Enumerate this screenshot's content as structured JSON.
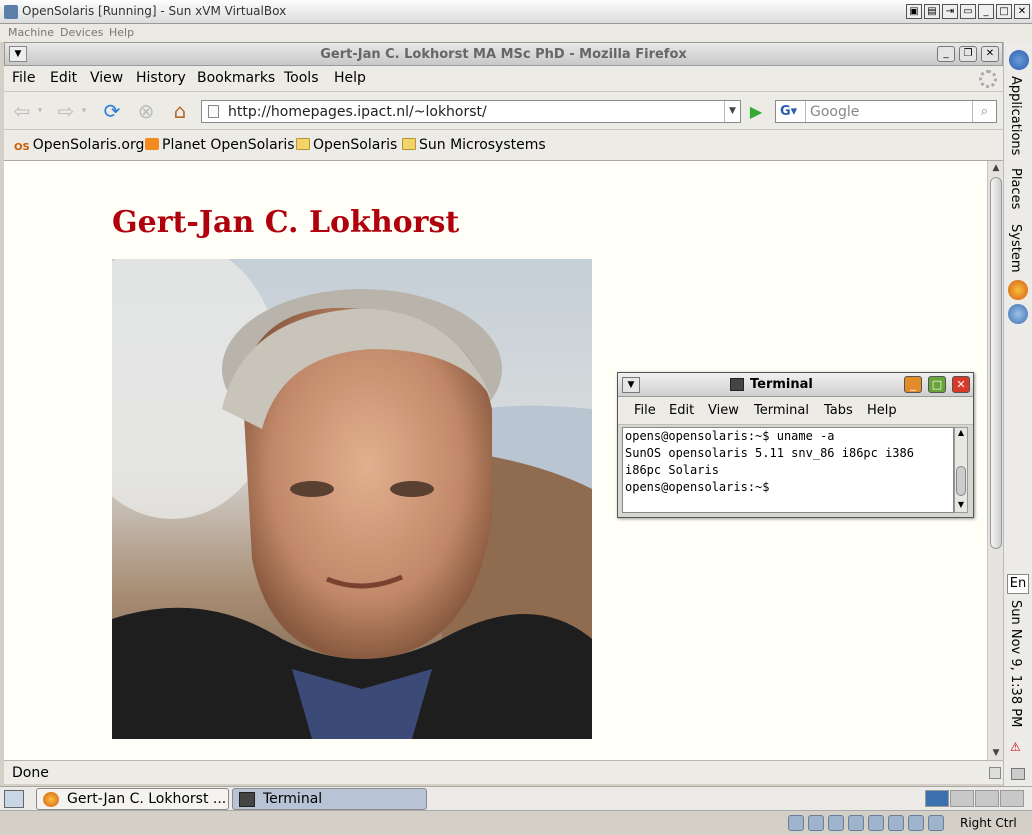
{
  "vbox": {
    "title": "OpenSolaris [Running] - Sun xVM VirtualBox",
    "menu": [
      "Machine",
      "Devices",
      "Help"
    ],
    "status_host_key": "Right Ctrl"
  },
  "firefox": {
    "window_title": "Gert-Jan C. Lokhorst MA MSc PhD - Mozilla Firefox",
    "menu": [
      "File",
      "Edit",
      "View",
      "History",
      "Bookmarks",
      "Tools",
      "Help"
    ],
    "url": "http://homepages.ipact.nl/~lokhorst/",
    "search_placeholder": "Google",
    "bookmarks": [
      "OpenSolaris.org",
      "Planet OpenSolaris",
      "OpenSolaris",
      "Sun Microsystems"
    ],
    "status": "Done"
  },
  "page": {
    "heading": "Gert-Jan C. Lokhorst"
  },
  "panel": {
    "menus": [
      "Applications",
      "Places",
      "System"
    ],
    "lang": "En",
    "clock": "Sun Nov  9,  1:38 PM"
  },
  "taskbar": {
    "tasks": [
      "Gert-Jan C. Lokhorst ...",
      "Terminal"
    ]
  },
  "terminal": {
    "title": "Terminal",
    "menu": [
      "File",
      "Edit",
      "View",
      "Terminal",
      "Tabs",
      "Help"
    ],
    "lines": [
      "opens@opensolaris:~$ uname -a",
      "SunOS opensolaris 5.11 snv_86 i86pc i386",
      "i86pc Solaris",
      "opens@opensolaris:~$ "
    ]
  },
  "colors": {
    "heading": "#b0000c",
    "page_bg": "#fffff8",
    "panel_bg": "#ecebe7"
  }
}
